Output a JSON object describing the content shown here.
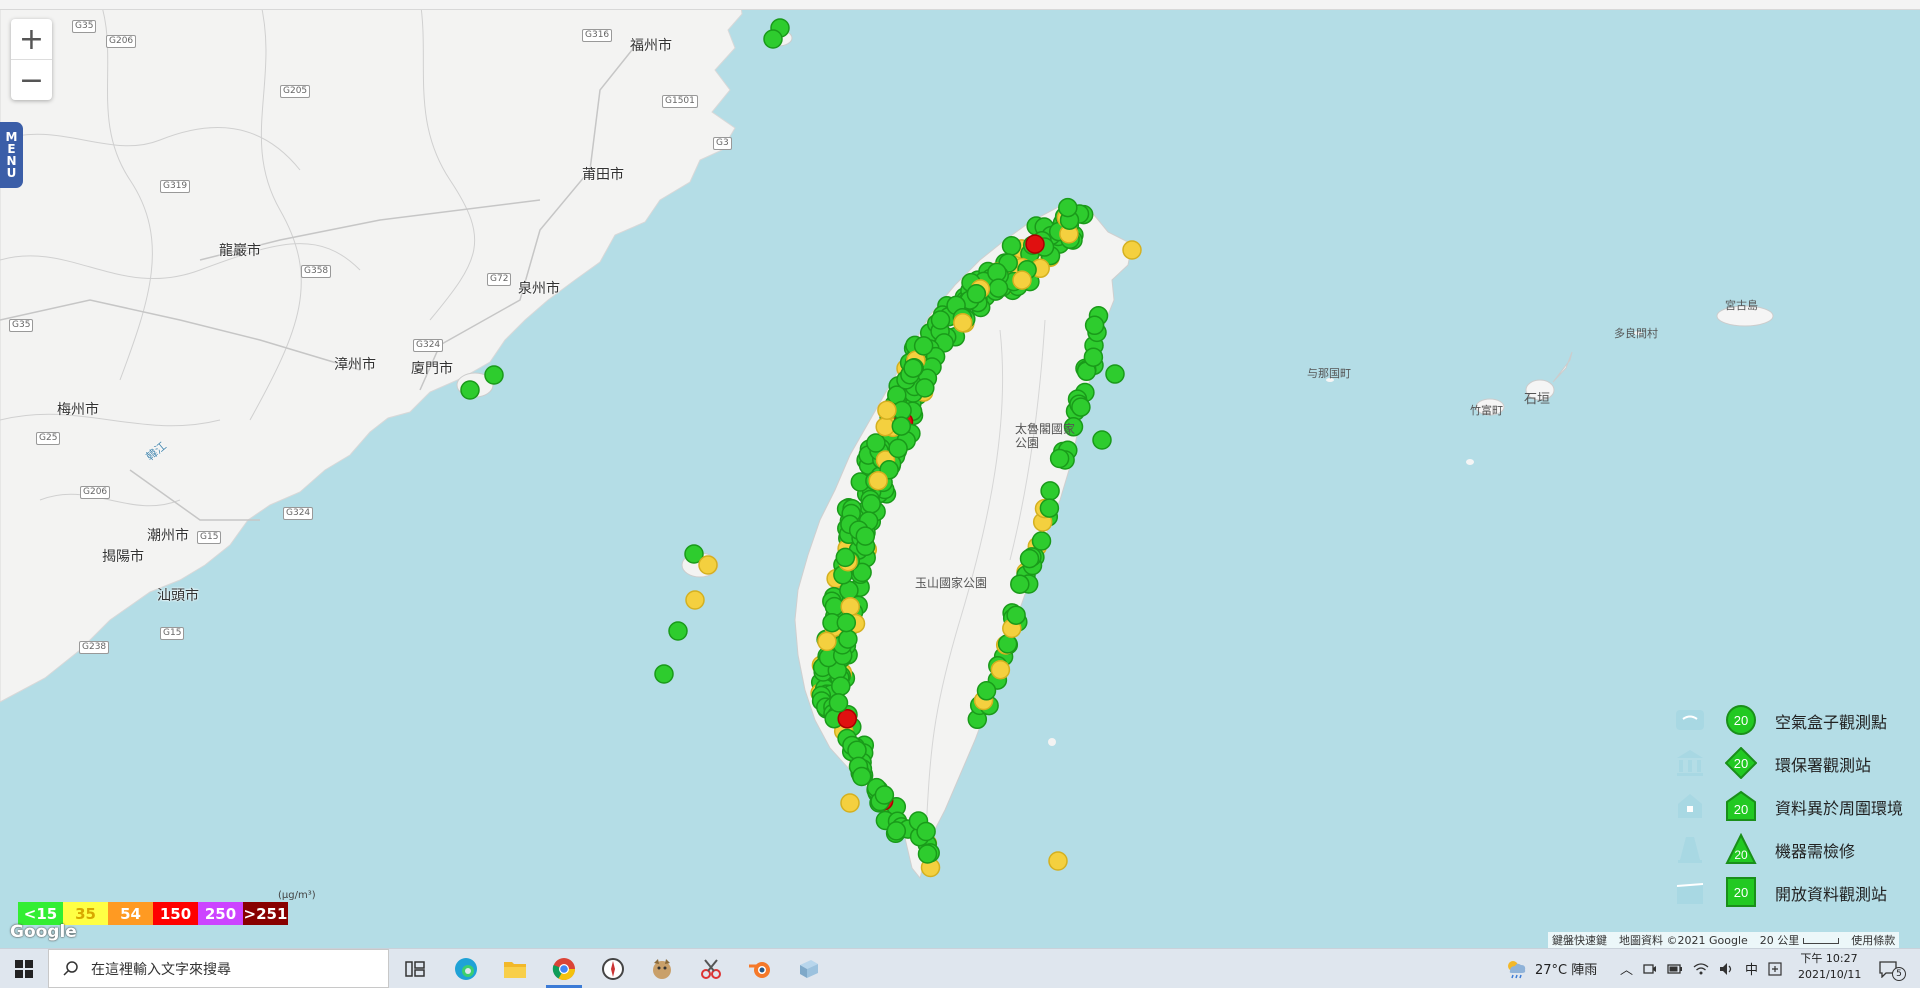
{
  "map": {
    "zoom_in": "+",
    "zoom_out": "−",
    "menu_letters": [
      "M",
      "E",
      "N",
      "U"
    ],
    "places": {
      "fuzhou": "福州市",
      "putian": "莆田市",
      "quanzhou": "泉州市",
      "longyan": "龍巖市",
      "zhangzhou": "漳州市",
      "xiamen": "廈門市",
      "meizhou": "梅州市",
      "chaozhou": "潮州市",
      "jieyang": "揭陽市",
      "shantou": "汕頭市",
      "hanjiang": "韓江",
      "miyako": "宮古島",
      "tarama": "多良間村",
      "yonaguni": "与那国町",
      "taketomi": "竹富町",
      "ishigaki": "石垣",
      "taroko": "太魯閣國家公園",
      "yushan": "玉山國家公園"
    },
    "roads": [
      "G35",
      "G206",
      "G316",
      "G205",
      "G1501",
      "G3",
      "G319",
      "G358",
      "G72",
      "G324",
      "G25",
      "G15",
      "G206",
      "G324",
      "G238",
      "G15",
      "G35"
    ],
    "marker_colors": {
      "green": "#2ecc2e",
      "yellow": "#f4d03f",
      "orange": "#f39c12",
      "red": "#e01010",
      "purple": "#b050e0",
      "dark": "#800000"
    }
  },
  "scale": {
    "unit": "(μg/m³)",
    "levels": [
      {
        "label": "<15",
        "color": "#33ee33"
      },
      {
        "label": "35",
        "color": "#ffff44"
      },
      {
        "label": "54",
        "color": "#ff9a22"
      },
      {
        "label": "150",
        "color": "#ff0000"
      },
      {
        "label": "250",
        "color": "#cc44ff"
      },
      {
        "label": ">251",
        "color": "#880000"
      }
    ]
  },
  "google_logo": "Google",
  "legend": [
    {
      "label": "空氣盒子觀測點",
      "icon": "airbox-icon",
      "mark": "circle",
      "value": "20"
    },
    {
      "label": "環保署觀測站",
      "icon": "government-building-icon",
      "mark": "diamond",
      "value": "20"
    },
    {
      "label": "資料異於周圍環境",
      "icon": "house-icon",
      "mark": "house",
      "value": "20"
    },
    {
      "label": "機器需檢修",
      "icon": "cone-icon",
      "mark": "triangle",
      "value": "20"
    },
    {
      "label": "開放資料觀測站",
      "icon": "open-data-icon",
      "mark": "square",
      "value": "20"
    }
  ],
  "attribution": {
    "shortcuts": "鍵盤快速鍵",
    "data": "地圖資料 ©2021 Google",
    "scale": "20 公里",
    "terms": "使用條款"
  },
  "taskbar": {
    "search_placeholder": "在這裡輸入文字來搜尋",
    "weather": "27°C  陣雨",
    "ime": "中",
    "time": "下午 10:27",
    "date": "2021/10/11",
    "notifications": "5"
  }
}
